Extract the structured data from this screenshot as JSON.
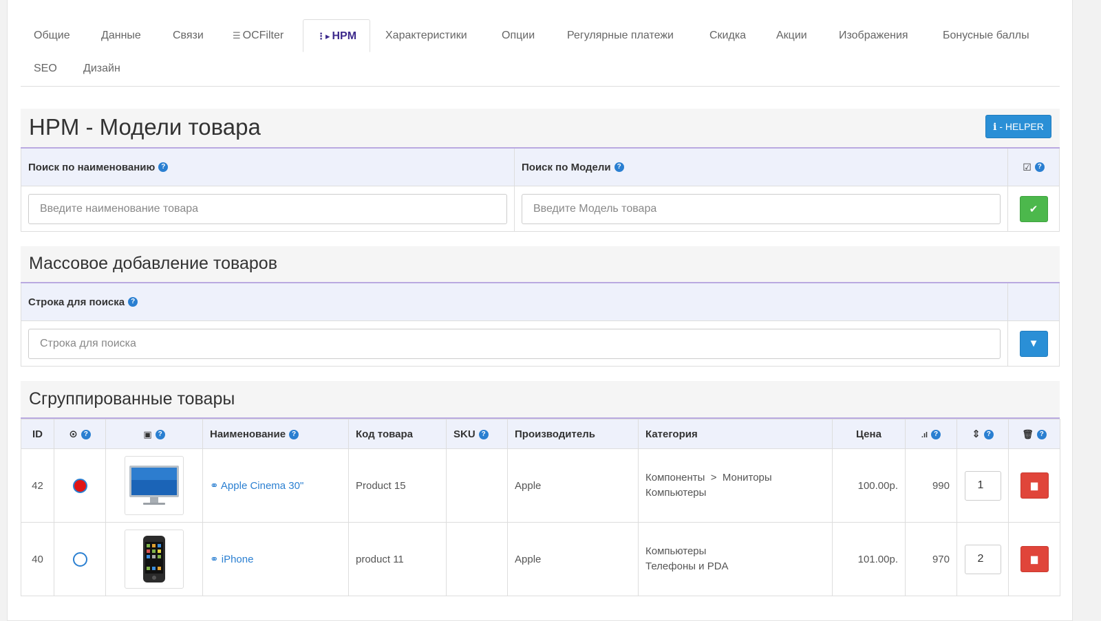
{
  "tabs": [
    {
      "label": "Общие",
      "icon": "",
      "active": false
    },
    {
      "label": "Данные",
      "icon": "",
      "active": false
    },
    {
      "label": "Связи",
      "icon": "",
      "active": false
    },
    {
      "label": "OCFilter",
      "icon": "sliders-icon",
      "active": false
    },
    {
      "label": "HPM",
      "icon": "sitemap-icon",
      "active": true
    },
    {
      "label": "Характеристики",
      "icon": "",
      "active": false
    },
    {
      "label": "Опции",
      "icon": "",
      "active": false
    },
    {
      "label": "Регулярные платежи",
      "icon": "",
      "active": false
    },
    {
      "label": "Скидка",
      "icon": "",
      "active": false
    },
    {
      "label": "Акции",
      "icon": "",
      "active": false
    },
    {
      "label": "Изображения",
      "icon": "",
      "active": false
    },
    {
      "label": "Бонусные баллы",
      "icon": "",
      "active": false
    },
    {
      "label": "SEO",
      "icon": "",
      "active": false
    },
    {
      "label": "Дизайн",
      "icon": "",
      "active": false
    }
  ],
  "models": {
    "title": "HPM - Модели товара",
    "helper_label": "- HELPER",
    "search_name_label": "Поиск по наименованию",
    "search_model_label": "Поиск по Модели",
    "search_name_placeholder": "Введите наименование товара",
    "search_model_placeholder": "Введите Модель товара"
  },
  "bulk": {
    "title": "Массовое добавление товаров",
    "search_label": "Строка для поиска",
    "search_placeholder": "Строка для поиска"
  },
  "grouped": {
    "title": "Сгруппированные товары",
    "columns": {
      "id": "ID",
      "name": "Наименование",
      "code": "Код товара",
      "sku": "SKU",
      "manufacturer": "Производитель",
      "category": "Категория",
      "price": "Цена"
    },
    "rows": [
      {
        "id": "42",
        "selected": true,
        "image": "monitor-image",
        "name": "Apple Cinema 30\"",
        "code": "Product 15",
        "sku": "",
        "manufacturer": "Apple",
        "category_line1": "Компоненты  >  Мониторы",
        "category_line2": "Компьютеры",
        "price": "100.00р.",
        "quantity": "990",
        "sort": "1"
      },
      {
        "id": "40",
        "selected": false,
        "image": "iphone-image",
        "name": "iPhone",
        "code": "product 11",
        "sku": "",
        "manufacturer": "Apple",
        "category_line1": "Компьютеры",
        "category_line2": "Телефоны и PDA",
        "price": "101.00р.",
        "quantity": "970",
        "sort": "2"
      }
    ]
  },
  "colors": {
    "accent_purple": "#3d2a8c",
    "underline": "#b9a9e0",
    "header_bg": "#eef1fb",
    "link_blue": "#2a7fd1",
    "green_btn": "#4cb84c",
    "blue_btn": "#2a8fd6",
    "red_btn": "#e0453a"
  }
}
